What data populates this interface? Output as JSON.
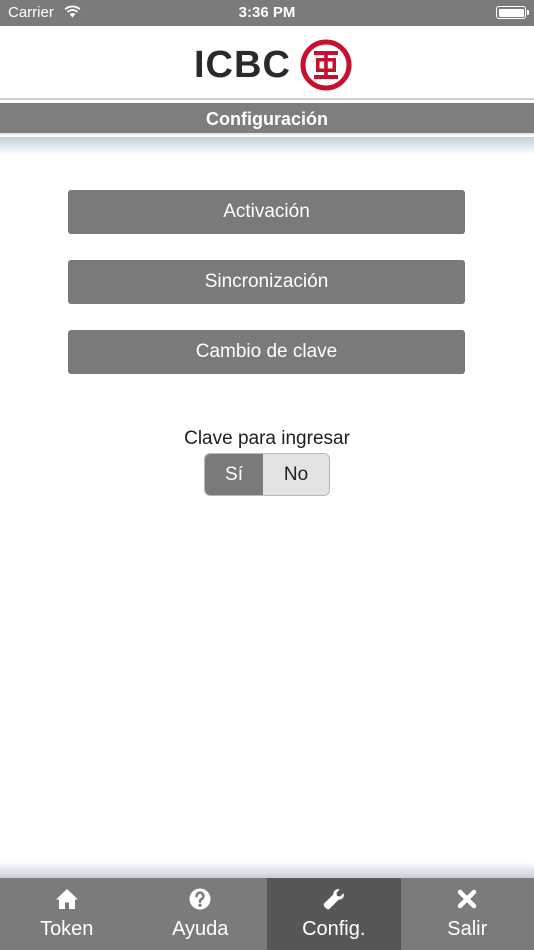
{
  "status_bar": {
    "carrier": "Carrier",
    "time": "3:36 PM"
  },
  "header": {
    "logo_text": "ICBC",
    "title": "Configuración"
  },
  "menu": {
    "buttons": [
      {
        "label": "Activación"
      },
      {
        "label": "Sincronización"
      },
      {
        "label": "Cambio de clave"
      }
    ]
  },
  "login_key": {
    "label": "Clave para ingresar",
    "options": [
      "Sí",
      "No"
    ],
    "selected": "Sí"
  },
  "tab_bar": {
    "tabs": [
      {
        "label": "Token",
        "icon": "home-icon"
      },
      {
        "label": "Ayuda",
        "icon": "help-icon"
      },
      {
        "label": "Config.",
        "icon": "wrench-icon",
        "active": true
      },
      {
        "label": "Salir",
        "icon": "close-icon"
      }
    ]
  },
  "colors": {
    "primary_gray": "#7a7a7a",
    "active_tab": "#575757",
    "logo_red": "#c8102e"
  }
}
